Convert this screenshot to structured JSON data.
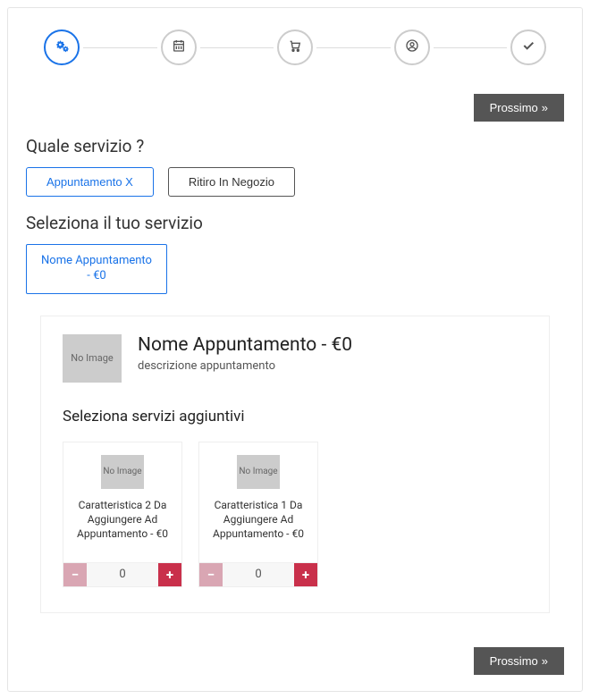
{
  "stepper": {
    "steps": [
      "settings",
      "calendar",
      "cart",
      "user",
      "check"
    ],
    "activeIndex": 0
  },
  "buttons": {
    "next": "Prossimo"
  },
  "serviceQuestion": {
    "title": "Quale servizio ?",
    "options": [
      {
        "label": "Appuntamento X",
        "selected": true
      },
      {
        "label": "Ritiro In Negozio",
        "selected": false
      }
    ]
  },
  "selectService": {
    "title": "Seleziona il tuo servizio",
    "items": [
      {
        "label": "Nome Appuntamento - €0"
      }
    ]
  },
  "detail": {
    "noImage": "No Image",
    "title": "Nome Appuntamento - €0",
    "description": "descrizione appuntamento"
  },
  "extras": {
    "title": "Seleziona servizi aggiuntivi",
    "items": [
      {
        "label": "Caratteristica 2 Da Aggiungere Ad Appuntamento - €0",
        "qty": 0
      },
      {
        "label": "Caratteristica 1 Da Aggiungere Ad Appuntamento - €0",
        "qty": 0
      }
    ]
  }
}
